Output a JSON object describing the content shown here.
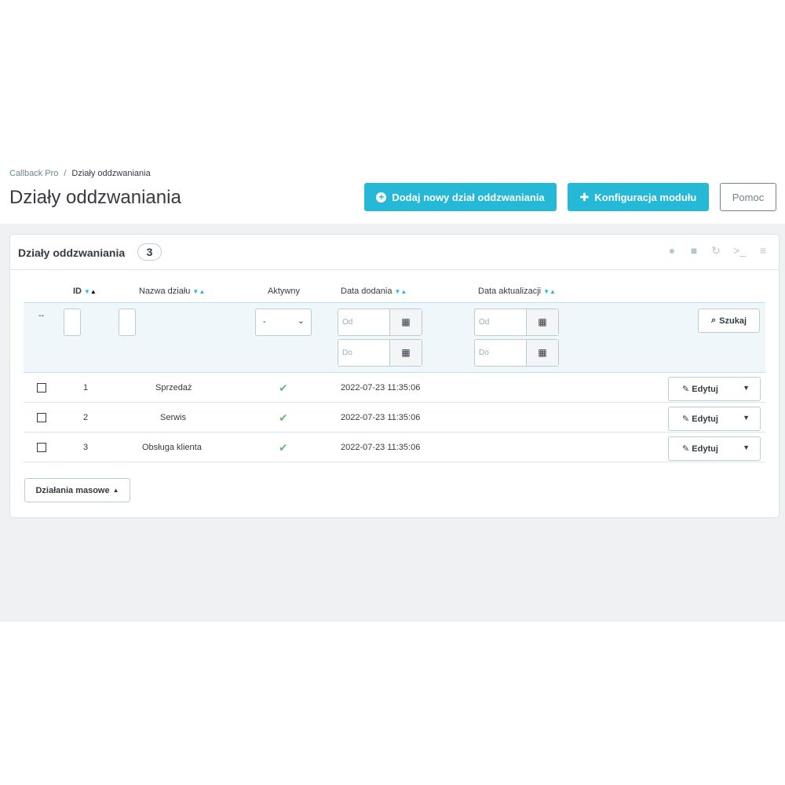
{
  "breadcrumb": {
    "parent": "Callback Pro",
    "separator": "/",
    "current": "Działy oddzwaniania"
  },
  "page": {
    "title": "Działy oddzwaniania"
  },
  "actions": {
    "add_label": "Dodaj nowy dział oddzwaniania",
    "config_label": "Konfiguracja modułu",
    "help_label": "Pomoc"
  },
  "panel": {
    "title": "Działy oddzwaniania",
    "count": "3",
    "toolbar_icons": [
      "plus-circle-icon",
      "export-icon",
      "refresh-icon",
      "sql-query-icon",
      "database-icon"
    ]
  },
  "table": {
    "columns": {
      "id": "ID",
      "name": "Nazwa działu",
      "active": "Aktywny",
      "date_add": "Data dodania",
      "date_upd": "Data aktualizacji"
    },
    "filters": {
      "bulk_placeholder": "--",
      "active_selected": "-",
      "from_placeholder": "Od",
      "to_placeholder": "Do",
      "search_label": "Szukaj"
    },
    "rows": [
      {
        "id": "1",
        "name": "Sprzedaż",
        "active": true,
        "date_add": "2022-07-23 11:35:06",
        "edit": "Edytuj"
      },
      {
        "id": "2",
        "name": "Serwis",
        "active": true,
        "date_add": "2022-07-23 11:35:06",
        "edit": "Edytuj"
      },
      {
        "id": "3",
        "name": "Obsługa klienta",
        "active": true,
        "date_add": "2022-07-23 11:35:06",
        "edit": "Edytuj"
      }
    ]
  },
  "bulk_actions": {
    "label": "Działania masowe"
  },
  "colors": {
    "accent": "#25b9d7",
    "success": "#70b580",
    "page_bg": "#eff1f2"
  }
}
